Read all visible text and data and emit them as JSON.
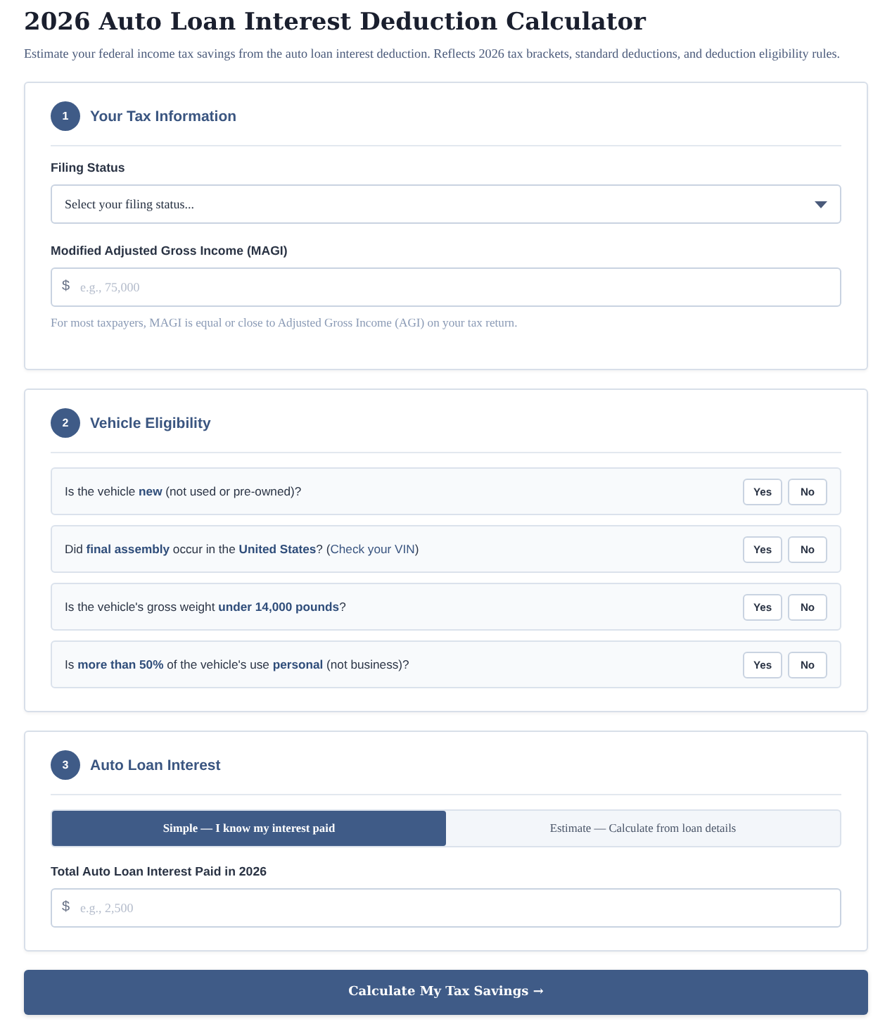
{
  "title": "2026 Auto Loan Interest Deduction Calculator",
  "subtitle": "Estimate your federal income tax savings from the auto loan interest deduction. Reflects 2026 tax brackets, standard deductions, and deduction eligibility rules.",
  "tax_info": {
    "step": "1",
    "heading": "Your Tax Information",
    "filing_label": "Filing Status",
    "filing_select": "Select your filing status...",
    "magi_label": "Modified Adjusted Gross Income (MAGI)",
    "magi_prefix": "$",
    "magi_placeholder": "e.g., 75,000",
    "magi_hint": "For most taxpayers, MAGI is equal or close to Adjusted Gross Income (AGI) on your tax return."
  },
  "eligibility": {
    "step": "2",
    "heading": "Vehicle Eligibility",
    "questions": [
      {
        "text": "Is the vehicle **new** (not used or pre-owned)?",
        "options": [
          {
            "label": "Yes",
            "selected": false
          },
          {
            "label": "No",
            "selected": false
          }
        ]
      },
      {
        "text": "Did **final assembly** occur in the **United States**? (",
        "link": "Check your VIN",
        "after": ")",
        "options": [
          {
            "label": "Yes",
            "selected": false
          },
          {
            "label": "No",
            "selected": false
          }
        ]
      },
      {
        "text": "Is the vehicle's gross weight **under 14,000 pounds**?",
        "options": [
          {
            "label": "Yes",
            "selected": false
          },
          {
            "label": "No",
            "selected": false
          }
        ]
      },
      {
        "text": "Is **more than 50%** of the vehicle's use **personal** (not business)?",
        "options": [
          {
            "label": "Yes",
            "selected": false
          },
          {
            "label": "No",
            "selected": false
          }
        ]
      }
    ]
  },
  "loan_interest": {
    "step": "3",
    "heading": "Auto Loan Interest",
    "modes": [
      {
        "label": "Simple — I know my interest paid",
        "selected": true
      },
      {
        "label": "Estimate — Calculate from loan details",
        "selected": false
      }
    ],
    "interest_label": "Total Auto Loan Interest Paid in 2026",
    "interest_prefix": "$",
    "interest_placeholder": "e.g., 2,500"
  },
  "submit": "Calculate My Tax Savings →"
}
